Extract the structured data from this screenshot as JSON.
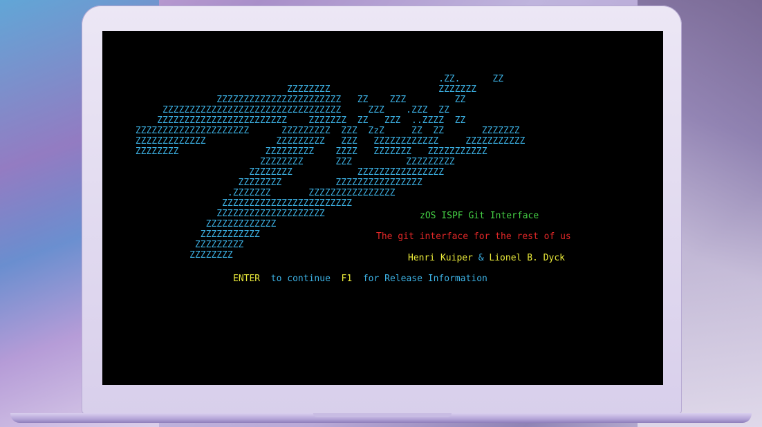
{
  "logo_art": "                                                         .ZZ.      ZZ\n                             ZZZZZZZZ                    ZZZZZZZ\n                ZZZZZZZZZZZZZZZZZZZZZZZ   ZZ    ZZZ         ZZ\n      ZZZZZZZZZZZZZZZZZZZZZZZZZZZZZZZZZ     ZZZ    .ZZZ  ZZ\n     ZZZZZZZZZZZZZZZZZZZZZZZZ    ZZZZZZZ  ZZ   ZZZ  ..ZZZZ  ZZ\n ZZZZZZZZZZZZZZZZZZZZZ      ZZZZZZZZZ  ZZZ  ZzZ     ZZ  ZZ       ZZZZZZZ\n ZZZZZZZZZZZZZ             ZZZZZZZZZ   ZZZ   ZZZZZZZZZZZZ     ZZZZZZZZZZZ\n ZZZZZZZZ                ZZZZZZZZZ    ZZZZ   ZZZZZZZ   ZZZZZZZZZZZ\n                        ZZZZZZZZ      ZZZ          ZZZZZZZZZ\n                      ZZZZZZZZ            ZZZZZZZZZZZZZZZZ\n                    ZZZZZZZZ          ZZZZZZZZZZZZZZZZ\n                  .ZZZZZZZ       ZZZZZZZZZZZZZZZZ\n                 ZZZZZZZZZZZZZZZZZZZZZZZZ\n                ZZZZZZZZZZZZZZZZZZZZ\n              ZZZZZZZZZZZZZ\n             ZZZZZZZZZZZ\n            ZZZZZZZZZ\n           ZZZZZZZZ",
  "subtitle": "zOS ISPF Git Interface",
  "tagline": "The git interface for the rest of us",
  "authors": {
    "author1": "Henri Kuiper",
    "amp": "&",
    "author2": "Lionel B. Dyck"
  },
  "prompt": {
    "key1": "ENTER",
    "text1": "to continue",
    "key2": "F1",
    "text2": "for Release Information"
  },
  "colors": {
    "logo": "#3db3e6",
    "subtitle": "#45d045",
    "tagline": "#e32828",
    "authors": "#eaea3a",
    "keys": "#eaea3a",
    "prompt_text": "#3db3e6"
  }
}
